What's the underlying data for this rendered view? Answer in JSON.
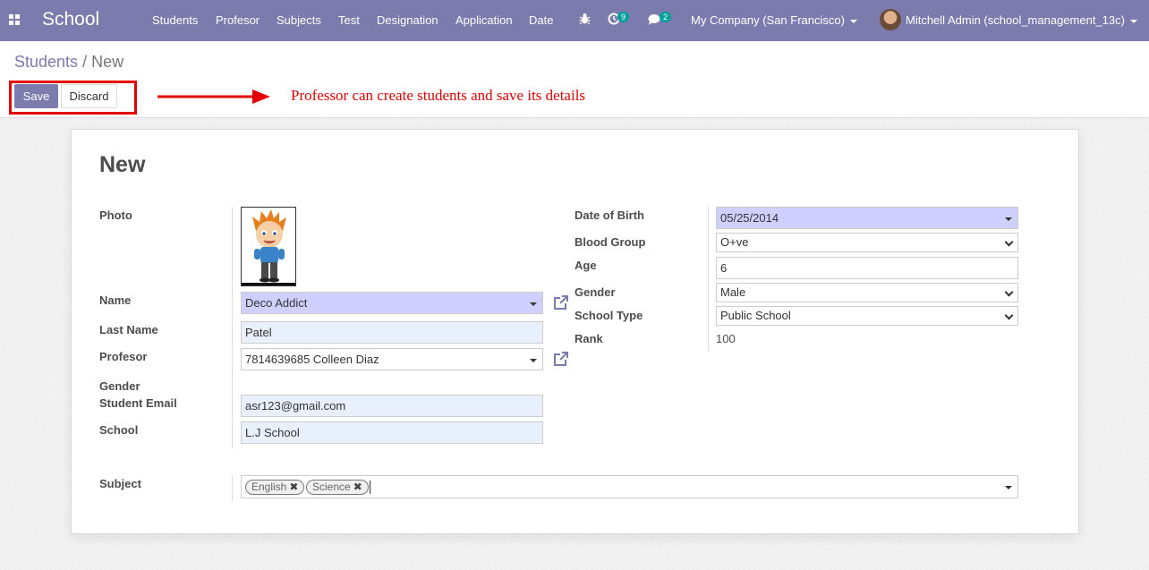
{
  "navbar": {
    "brand": "School",
    "menu": [
      "Students",
      "Profesor",
      "Subjects",
      "Test",
      "Designation",
      "Application",
      "Date"
    ],
    "activity_count": "9",
    "messages_count": "2",
    "company": "My Company (San Francisco)",
    "user": "Mitchell Admin (school_management_13c)",
    "accent_color": "#7c7bad"
  },
  "breadcrumb": {
    "parent": "Students",
    "separator": "/",
    "current": "New"
  },
  "buttons": {
    "save": "Save",
    "discard": "Discard"
  },
  "annotation": {
    "text": "Professor can create students and save its details",
    "color": "#e30000"
  },
  "form": {
    "title": "New",
    "labels": {
      "photo": "Photo",
      "name": "Name",
      "last_name": "Last Name",
      "profesor": "Profesor",
      "gender": "Gender",
      "student_email": "Student Email",
      "school": "School",
      "date_of_birth": "Date of Birth",
      "blood_group": "Blood Group",
      "age": "Age",
      "gender_right": "Gender",
      "school_type": "School Type",
      "rank": "Rank",
      "subject": "Subject"
    },
    "values": {
      "name": "Deco Addict",
      "last_name": "Patel",
      "profesor": "7814639685 Colleen Diaz",
      "student_email": "asr123@gmail.com",
      "school": "L.J School",
      "date_of_birth": "05/25/2014",
      "blood_group": "O+ve",
      "age": "6",
      "gender": "Male",
      "school_type": "Public School",
      "rank": "100"
    },
    "subjects": [
      "English",
      "Science"
    ]
  }
}
